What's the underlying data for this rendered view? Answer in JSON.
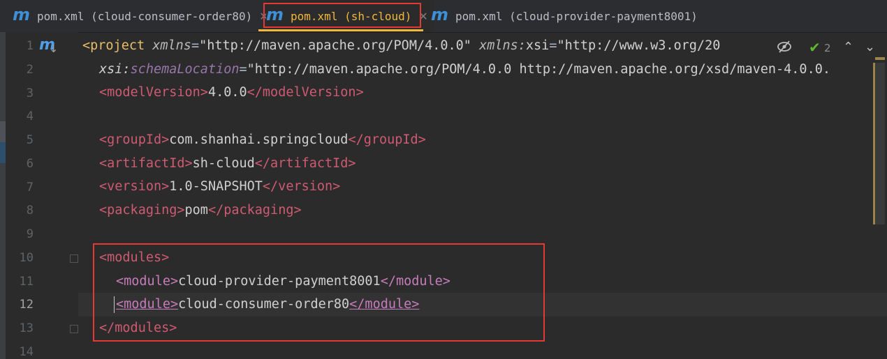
{
  "tabs": [
    {
      "icon": "m",
      "label": "pom.xml (cloud-consumer-order80)",
      "active": false,
      "close": "✕"
    },
    {
      "icon": "m",
      "label": "pom.xml (sh-cloud)",
      "active": true,
      "close": "✕"
    },
    {
      "icon": "m",
      "label": "pom.xml (cloud-provider-payment8001)",
      "active": false,
      "close": ""
    }
  ],
  "editor": {
    "line_numbers": [
      "1",
      "2",
      "3",
      "4",
      "5",
      "6",
      "7",
      "8",
      "9",
      "10",
      "11",
      "12",
      "13",
      "14"
    ],
    "current_line": 12,
    "gutter_icon": "maven-icon",
    "lines": {
      "l1": {
        "open": "<project ",
        "a1": "xmlns",
        "eq1": "=",
        "v1": "\"http://maven.apache.org/POM/4.0.0\"",
        "sp": " ",
        "a2p": "xmlns:",
        "a2": "xsi",
        "eq2": "=",
        "v2": "\"http://www.w3.org/20"
      },
      "l2": {
        "a1p": "xsi:",
        "a1": "schemaLocation",
        "eq": "=",
        "v": "\"http://maven.apache.org/POM/4.0.0 http://maven.apache.org/xsd/maven-4.0.0."
      },
      "l3": {
        "o": "<modelVersion>",
        "txt": "4.0.0",
        "c": "</modelVersion>"
      },
      "l5": {
        "o": "<groupId>",
        "txt": "com.shanhai.springcloud",
        "c": "</groupId>"
      },
      "l6": {
        "o": "<artifactId>",
        "txt": "sh-cloud",
        "c": "</artifactId>"
      },
      "l7": {
        "o": "<version>",
        "txt": "1.0-SNAPSHOT",
        "c": "</version>"
      },
      "l8": {
        "o": "<packaging>",
        "txt": "pom",
        "c": "</packaging>"
      },
      "l10": {
        "o": "<modules>"
      },
      "l11": {
        "o": "<module>",
        "txt": "cloud-provider-payment8001",
        "c": "</module>"
      },
      "l12": {
        "o": "<module>",
        "txt": "cloud-consumer-order80",
        "c": "</module>"
      },
      "l13": {
        "c": "</modules>"
      }
    }
  },
  "toolbar": {
    "inspection_count": "2",
    "check_icon": "check-icon",
    "eye_icon": "eye-slash-icon"
  },
  "colors": {
    "accent": "#f0b73b",
    "highlight_box": "#e53935",
    "maven_blue": "#3d8fd6"
  }
}
